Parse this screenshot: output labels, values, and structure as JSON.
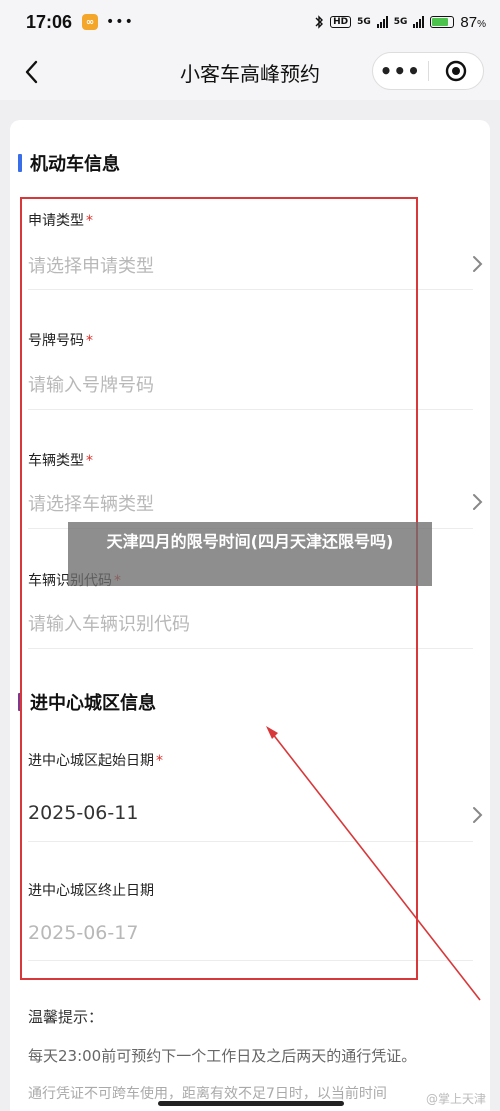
{
  "status_bar": {
    "time": "17:06",
    "app_badge_glyph": "∞",
    "more_dots": "•••",
    "hd": "HD",
    "net1": "5G",
    "net2": "5G",
    "battery_pct": "87"
  },
  "nav": {
    "title": "小客车高峰预约",
    "more_glyph": "•••"
  },
  "section1": {
    "title": "机动车信息",
    "fields": [
      {
        "label": "申请类型",
        "required": "*",
        "placeholder": "请选择申请类型"
      },
      {
        "label": "号牌号码",
        "required": "*",
        "placeholder": "请输入号牌号码"
      },
      {
        "label": "车辆类型",
        "required": "*",
        "placeholder": "请选择车辆类型"
      },
      {
        "label": "车辆识别代码",
        "required": "*",
        "placeholder": "请输入车辆识别代码"
      }
    ]
  },
  "section2": {
    "title": "进中心城区信息",
    "fields": [
      {
        "label": "进中心城区起始日期",
        "required": "*",
        "value": "2025-06-11"
      },
      {
        "label": "进中心城区终止日期",
        "required": "",
        "value": "2025-06-17"
      }
    ]
  },
  "banner": {
    "text": "天津四月的限号时间(四月天津还限号吗)"
  },
  "tips": {
    "title": "温馨提示：",
    "line1": "每天23:00前可预约下一个工作日及之后两天的通行凭证。",
    "line2": "通行凭证不可跨车使用，距离有效不足7日时，以当前时间"
  },
  "watermark": "@掌上天津",
  "colors": {
    "accent_blue": "#3a6ee8",
    "accent_purple": "#7a3a8e",
    "required_red": "#e0302b",
    "annotation_red": "#d8383a"
  }
}
